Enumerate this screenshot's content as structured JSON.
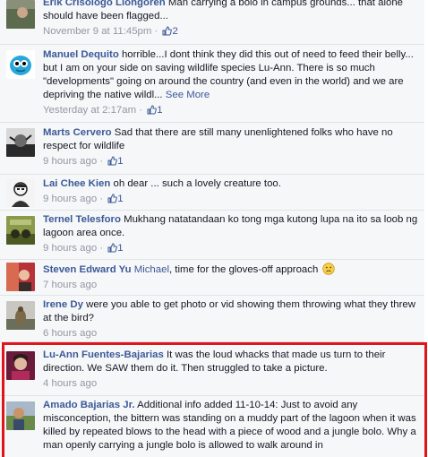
{
  "accent_link": "#3b5998",
  "highlight_color": "#e1141b",
  "comments": [
    {
      "author": "Erik Crisologo Liongoren",
      "text": "Man carrying a bolo in campus grounds... that alone should have been flagged...",
      "time": "November 9 at 11:45pm",
      "likes": "2",
      "avatar": "partial-photo-avatar"
    },
    {
      "author": "Manuel Dequito",
      "text": "horrible...I dont think they did this out of need to feed their belly... but I am on your side on saving wildlife species Lu-Ann. There is so much \"developments\" going on around the country (and even in the world) and we are depriving the native wildl...",
      "see_more": "See More",
      "time": "Yesterday at 2:17am",
      "likes": "1",
      "avatar": "blue-cartoon-avatar"
    },
    {
      "author": "Marts Cervero",
      "text": "Sad that there are still many unenlightened folks who have no respect for wildlife",
      "time": "9 hours ago",
      "likes": "1",
      "avatar": "black-white-photo-avatar"
    },
    {
      "author": "Lai Chee Kien",
      "text": "oh dear ... such a lovely creature too.",
      "time": "9 hours ago",
      "likes": "1",
      "avatar": "sketch-portrait-avatar"
    },
    {
      "author": "Ternel Telesforo",
      "text": "Mukhang natatandaan ko tong mga kutong lupa na ito sa loob ng lagoon area once.",
      "time": "9 hours ago",
      "likes": "1",
      "avatar": "olive-photo-avatar"
    },
    {
      "author": "Steven Edward Yu",
      "mention": "Michael",
      "text": ", time for the gloves-off approach",
      "emoji": "frown-emoji",
      "time": "7 hours ago",
      "avatar": "red-photo-avatar"
    },
    {
      "author": "Irene Dy",
      "text": "were you able to get photo or vid showing them throwing what they threw at the bird?",
      "time": "6 hours ago",
      "avatar": "bird-photo-avatar"
    },
    {
      "author": "Lu-Ann Fuentes-Bajarias",
      "text": "It was the loud whacks that made us turn to their direction. We SAW them do it. Then struggled to take a picture.",
      "time": "4 hours ago",
      "avatar": "pink-portrait-avatar"
    },
    {
      "author": "Amado Bajarias Jr.",
      "text": "Additional info added 11-10-14: Just to avoid any misconception, the bittern was standing on a muddy part of the lagoon when it was killed by repeated blows to the head with a piece of wood and a jungle bolo. Why a man openly carrying a jungle bolo is allowed to walk around in",
      "avatar": "outdoor-portrait-avatar"
    }
  ]
}
